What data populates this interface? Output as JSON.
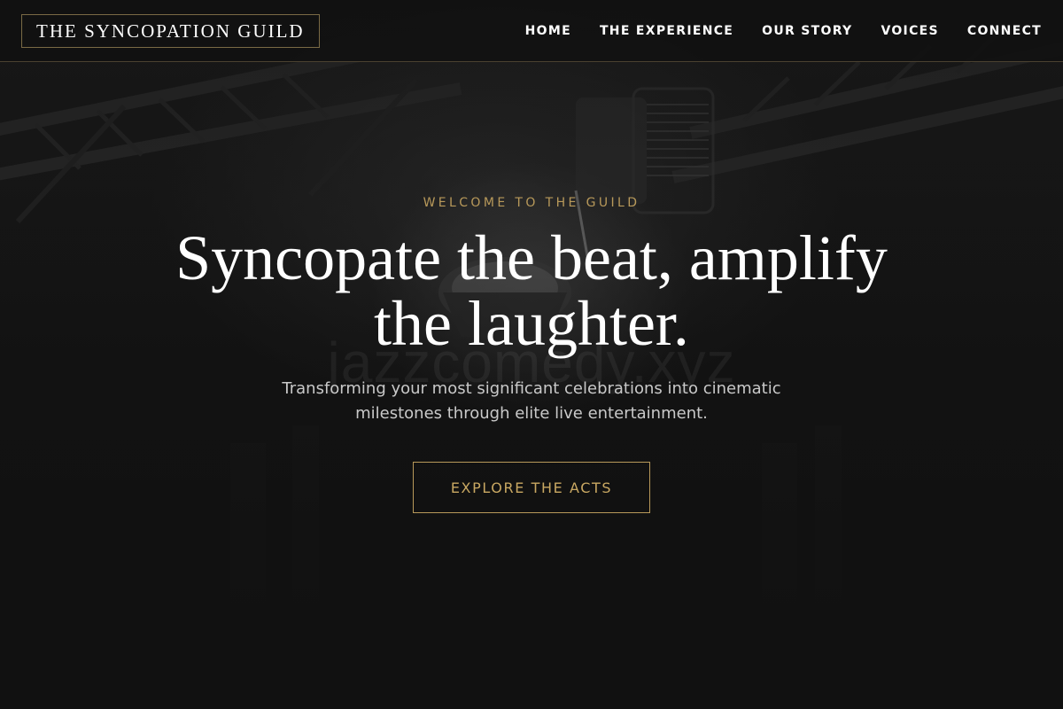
{
  "header": {
    "logo_text": "THE SYNCOPATION GUILD",
    "nav": [
      {
        "label": "HOME"
      },
      {
        "label": "THE EXPERIENCE"
      },
      {
        "label": "OUR STORY"
      },
      {
        "label": "VOICES"
      },
      {
        "label": "CONNECT"
      }
    ]
  },
  "hero": {
    "eyebrow": "WELCOME TO THE GUILD",
    "headline": "Syncopate the beat, amplify the laughter.",
    "subtext": "Transforming your most significant celebrations into cinematic milestones through elite live entertainment.",
    "cta_label": "EXPLORE THE ACTS",
    "watermark": "jazzcomedy.xyz"
  },
  "colors": {
    "background": "#111111",
    "accent_gold": "#b8995a",
    "header_border": "#4a4130",
    "text_primary": "#ffffff",
    "text_secondary": "#c9c9c9"
  }
}
